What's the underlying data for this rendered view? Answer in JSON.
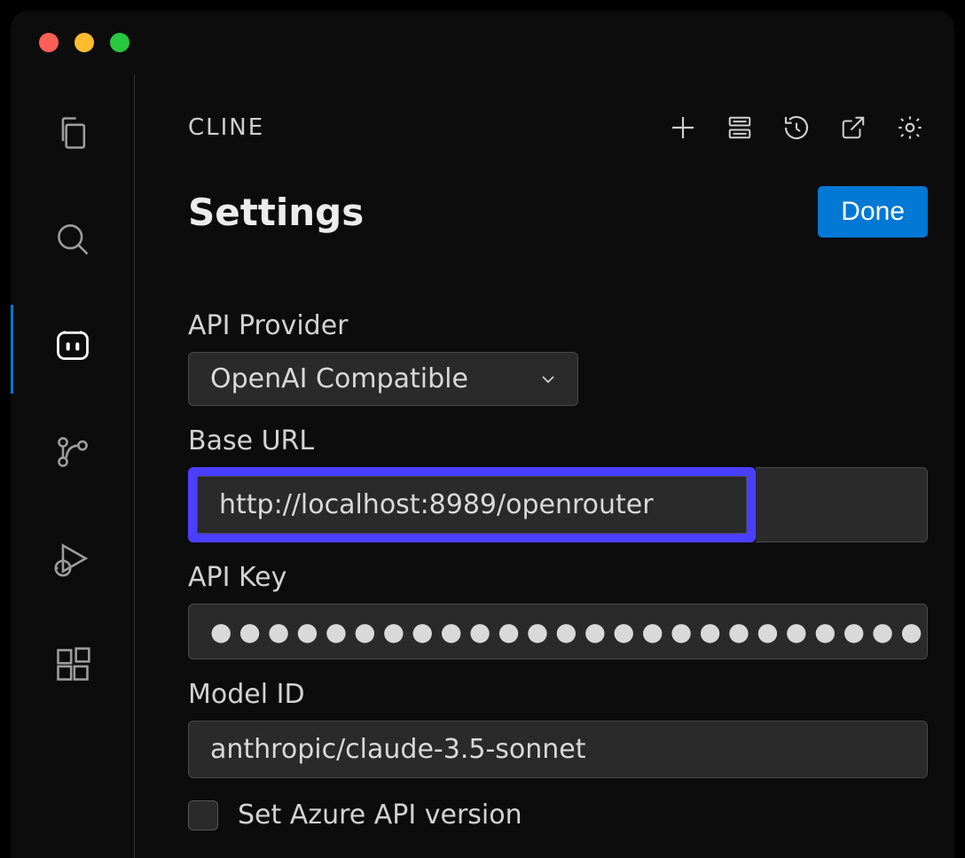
{
  "panel": {
    "title": "CLINE"
  },
  "settings": {
    "heading": "Settings",
    "done_label": "Done",
    "fields": {
      "api_provider": {
        "label": "API Provider",
        "value": "OpenAI Compatible"
      },
      "base_url": {
        "label": "Base URL",
        "value": "http://localhost:8989/openrouter"
      },
      "api_key": {
        "label": "API Key",
        "masked": "●●●●●●●●●●●●●●●●●●●●●●●●●●●●●●●●●●●●●●●●●●"
      },
      "model_id": {
        "label": "Model ID",
        "value": "anthropic/claude-3.5-sonnet"
      },
      "set_azure": {
        "label": "Set Azure API version",
        "checked": false
      }
    }
  },
  "colors": {
    "accent": "#0078d4",
    "highlight": "#4b3fff"
  }
}
